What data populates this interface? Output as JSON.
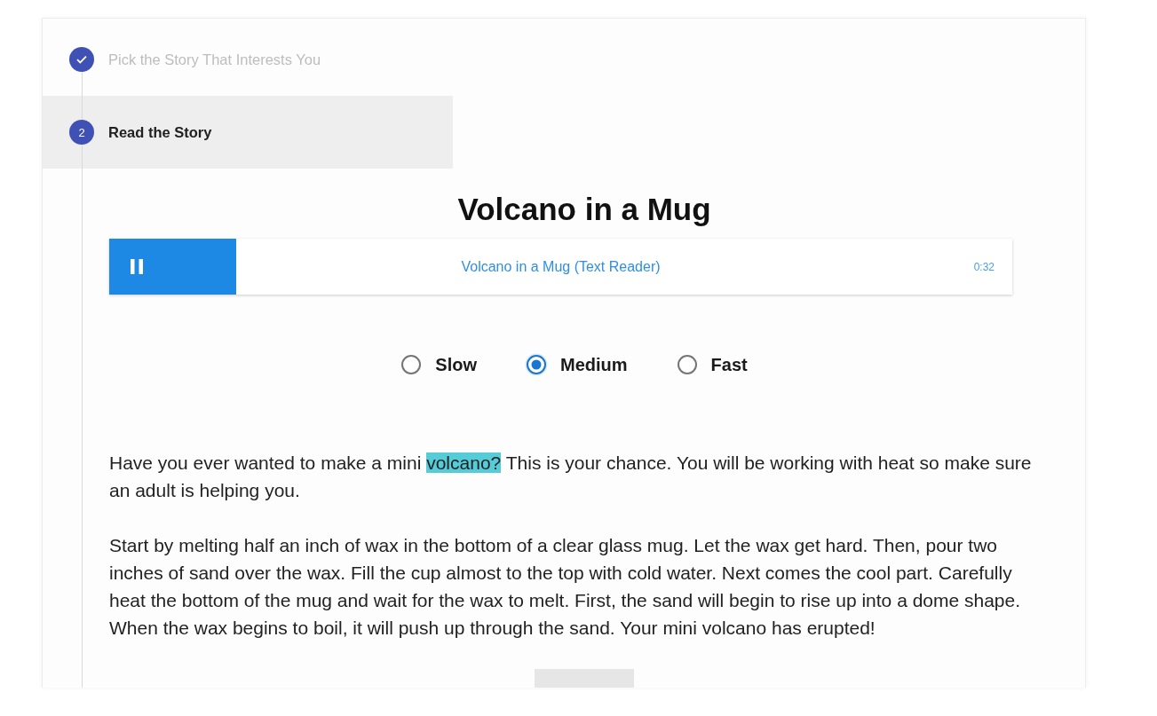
{
  "stepper": {
    "steps": [
      {
        "label": "Pick the Story That Interests You",
        "completed": true,
        "selected": false
      },
      {
        "number": "2",
        "label": "Read the Story",
        "completed": false,
        "selected": true
      }
    ]
  },
  "story": {
    "title": "Volcano in a Mug",
    "player": {
      "playing": true,
      "title": "Volcano in a Mug (Text Reader)",
      "time": "0:32"
    },
    "speeds": [
      {
        "label": "Slow",
        "selected": false
      },
      {
        "label": "Medium",
        "selected": true
      },
      {
        "label": "Fast",
        "selected": false
      }
    ],
    "paragraphs": [
      {
        "segments": [
          {
            "text": "Have you ever wanted to make a mini ",
            "highlighted": false
          },
          {
            "text": "volcano?",
            "highlighted": true
          },
          {
            "text": " This is your chance. You will be working with heat so make sure an adult is helping you.",
            "highlighted": false
          }
        ]
      },
      {
        "segments": [
          {
            "text": "Start by melting half an inch of wax in the bottom of a clear glass mug. Let the wax get hard. Then, pour two inches of sand over the wax. Fill the cup almost to the top with cold water. Next comes the cool part. Carefully heat the bottom of the mug and wait for the wax to melt. First, the sand will begin to rise up into a dome shape. When the wax begins to boil, it will push up through the sand. Your mini volcano has erupted!",
            "highlighted": false
          }
        ]
      }
    ]
  }
}
